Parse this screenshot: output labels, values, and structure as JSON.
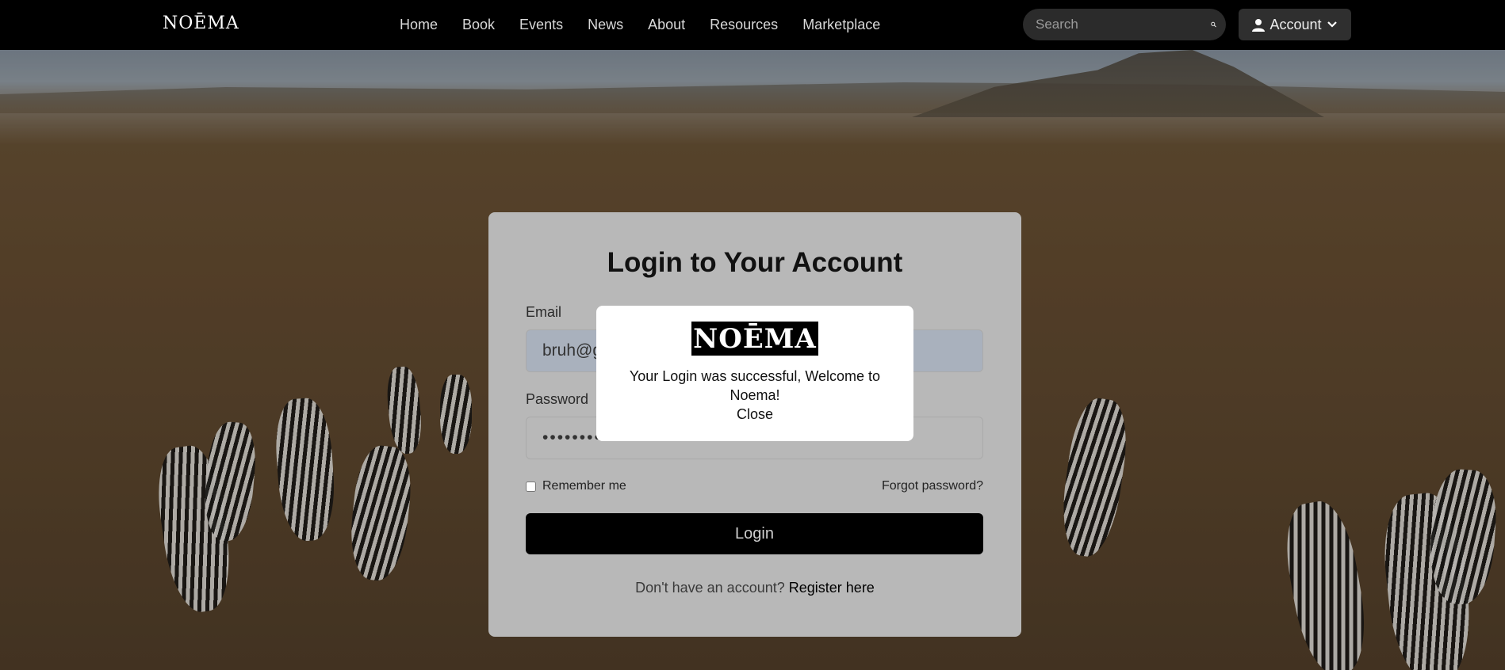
{
  "nav": {
    "logo": "NOĒMA",
    "links": [
      "Home",
      "Book",
      "Events",
      "News",
      "About",
      "Resources",
      "Marketplace"
    ],
    "search_placeholder": "Search",
    "account_label": "Account"
  },
  "login": {
    "title": "Login to Your Account",
    "email_label": "Email",
    "email_value": "bruh@g",
    "password_label": "Password",
    "password_value": "••••••••••••",
    "remember_label": "Remember me",
    "forgot_label": "Forgot password?",
    "login_button": "Login",
    "register_prompt": "Don't have an account?",
    "register_link": "Register here"
  },
  "modal": {
    "logo": "NOĒMA",
    "message": "Your Login was successful, Welcome to Noema!",
    "close_label": "Close"
  },
  "colors": {
    "nav_bg": "#000000",
    "card_bg": "#b8b8b8",
    "button_bg": "#000000"
  }
}
